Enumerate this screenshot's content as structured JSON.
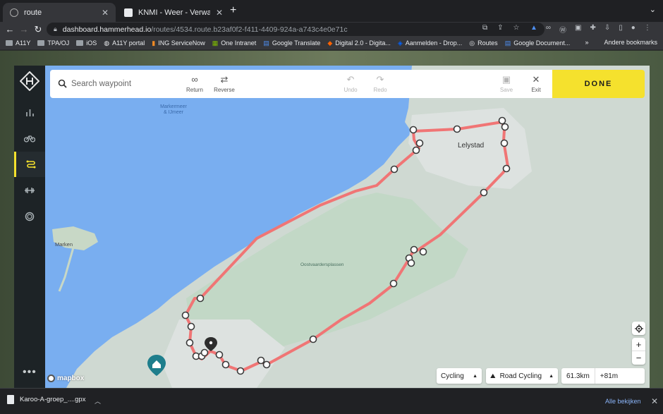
{
  "browser": {
    "tabs": [
      {
        "title": "route",
        "active": true
      },
      {
        "title": "KNMI - Weer - Verwachtingen",
        "active": false
      }
    ],
    "url_host": "dashboard.hammerhead.io",
    "url_path": "/routes/4534.route.b23af0f2-f411-4409-924a-a743c4e0e71c",
    "bookmarks": [
      "A11Y",
      "TPA/OJ",
      "iOS",
      "A11Y portal",
      "ING ServiceNow",
      "One Intranet",
      "Google Translate",
      "Digital 2.0 - Digita...",
      "Aanmelden - Drop...",
      "Routes",
      "Google Document..."
    ],
    "other_bookmarks": "Andere bookmarks"
  },
  "toolbar": {
    "search_placeholder": "Search waypoint",
    "return_label": "Return",
    "reverse_label": "Reverse",
    "undo_label": "Undo",
    "redo_label": "Redo",
    "save_label": "Save",
    "exit_label": "Exit",
    "done_label": "DONE"
  },
  "map": {
    "labels": {
      "markermeer": "Markermeer\n& IJmeer",
      "lelystad": "Lelystad",
      "marken": "Marken",
      "oostvaardersplassen": "Oostvaardersplassen"
    },
    "route_color": "#f07575",
    "water_color": "#79aef0",
    "land_color": "#cfd9d2"
  },
  "bottom_controls": {
    "sport": "Cycling",
    "profile": "Road Cycling",
    "distance": "61.3km",
    "elevation": "+81m"
  },
  "attribution": "mapbox",
  "downloads": {
    "file_name": "Karoo-A-groep_....gpx",
    "show_all": "Alle bekijken"
  }
}
